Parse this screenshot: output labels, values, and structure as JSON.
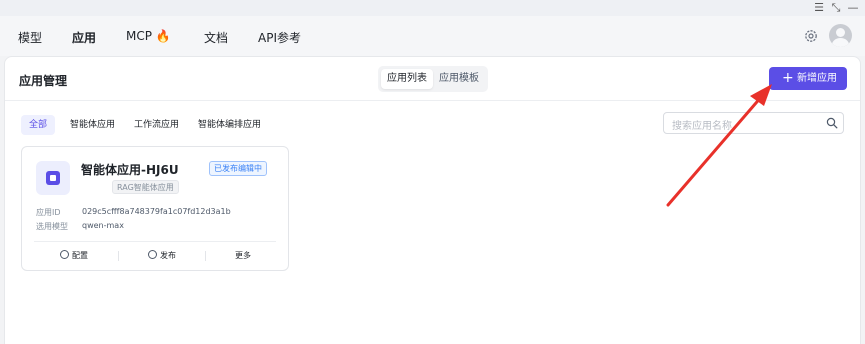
{
  "window": {
    "controls": [
      "☰",
      "⤡",
      "—"
    ]
  },
  "nav": {
    "tabs": [
      {
        "label": "模型"
      },
      {
        "label": "应用"
      },
      {
        "label": "MCP"
      },
      {
        "label": "文档"
      },
      {
        "label": "API参考"
      }
    ],
    "mcp_emoji": "🔥",
    "active_tab": "应用"
  },
  "header": {
    "title": "应用管理",
    "segments": [
      "应用列表",
      "应用模板"
    ],
    "active_segment": "应用列表",
    "add_button": "新增应用"
  },
  "filters": {
    "items": [
      "全部",
      "智能体应用",
      "工作流应用",
      "智能体编排应用"
    ],
    "active": "全部"
  },
  "search": {
    "placeholder": "搜索应用名称"
  },
  "card": {
    "name": "智能体应用-HJ6U",
    "status": "已发布编辑中",
    "type_tag": "RAG智能体应用",
    "id_label": "应用ID",
    "id_value": "029c5cfff8a748379fa1c07fd12d3a1b",
    "model_label": "选用模型",
    "model_value": "qwen-max",
    "actions": [
      "配置",
      "发布",
      "更多"
    ]
  },
  "colors": {
    "accent": "#5b4ee6",
    "annotation_arrow": "#e8312a",
    "status_blue": "#3b82f6"
  }
}
